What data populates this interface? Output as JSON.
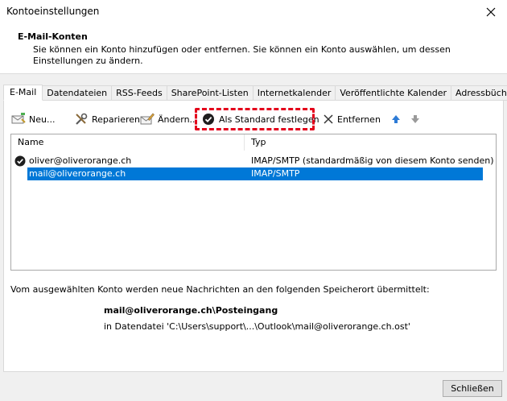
{
  "window": {
    "title": "Kontoeinstellungen"
  },
  "header": {
    "title": "E-Mail-Konten",
    "description": "Sie können ein Konto hinzufügen oder entfernen. Sie können ein Konto auswählen, um dessen Einstellungen zu ändern."
  },
  "tabs": [
    {
      "label": "E-Mail",
      "active": true
    },
    {
      "label": "Datendateien"
    },
    {
      "label": "RSS-Feeds"
    },
    {
      "label": "SharePoint-Listen"
    },
    {
      "label": "Internetkalender"
    },
    {
      "label": "Veröffentlichte Kalender"
    },
    {
      "label": "Adressbücher"
    }
  ],
  "toolbar": {
    "new_label": "Neu...",
    "repair_label": "Reparieren...",
    "change_label": "Ändern...",
    "default_label": "Als Standard festlegen",
    "remove_label": "Entfernen"
  },
  "list": {
    "columns": {
      "name": "Name",
      "type": "Typ"
    },
    "rows": [
      {
        "name": "oliver@oliverorange.ch",
        "type": "IMAP/SMTP (standardmäßig von diesem Konto senden)"
      },
      {
        "name": "mail@oliverorange.ch",
        "type": "IMAP/SMTP"
      }
    ]
  },
  "info": {
    "text": "Vom ausgewählten Konto werden neue Nachrichten an den folgenden Speicherort übermittelt:",
    "location": "mail@oliverorange.ch\\Posteingang",
    "path": "in Datendatei 'C:\\Users\\support\\...\\Outlook\\mail@oliverorange.ch.ost'"
  },
  "footer": {
    "close_label": "Schließen"
  },
  "colors": {
    "selection": "#0078d7",
    "highlight": "#e3001b",
    "arrow_up": "#2d7bd6",
    "arrow_down": "#9a9a9a"
  },
  "icons": [
    "close-icon",
    "new-account-icon",
    "repair-icon",
    "change-icon",
    "default-check-icon",
    "remove-x-icon",
    "arrow-up-icon",
    "arrow-down-icon",
    "default-account-check-icon"
  ]
}
